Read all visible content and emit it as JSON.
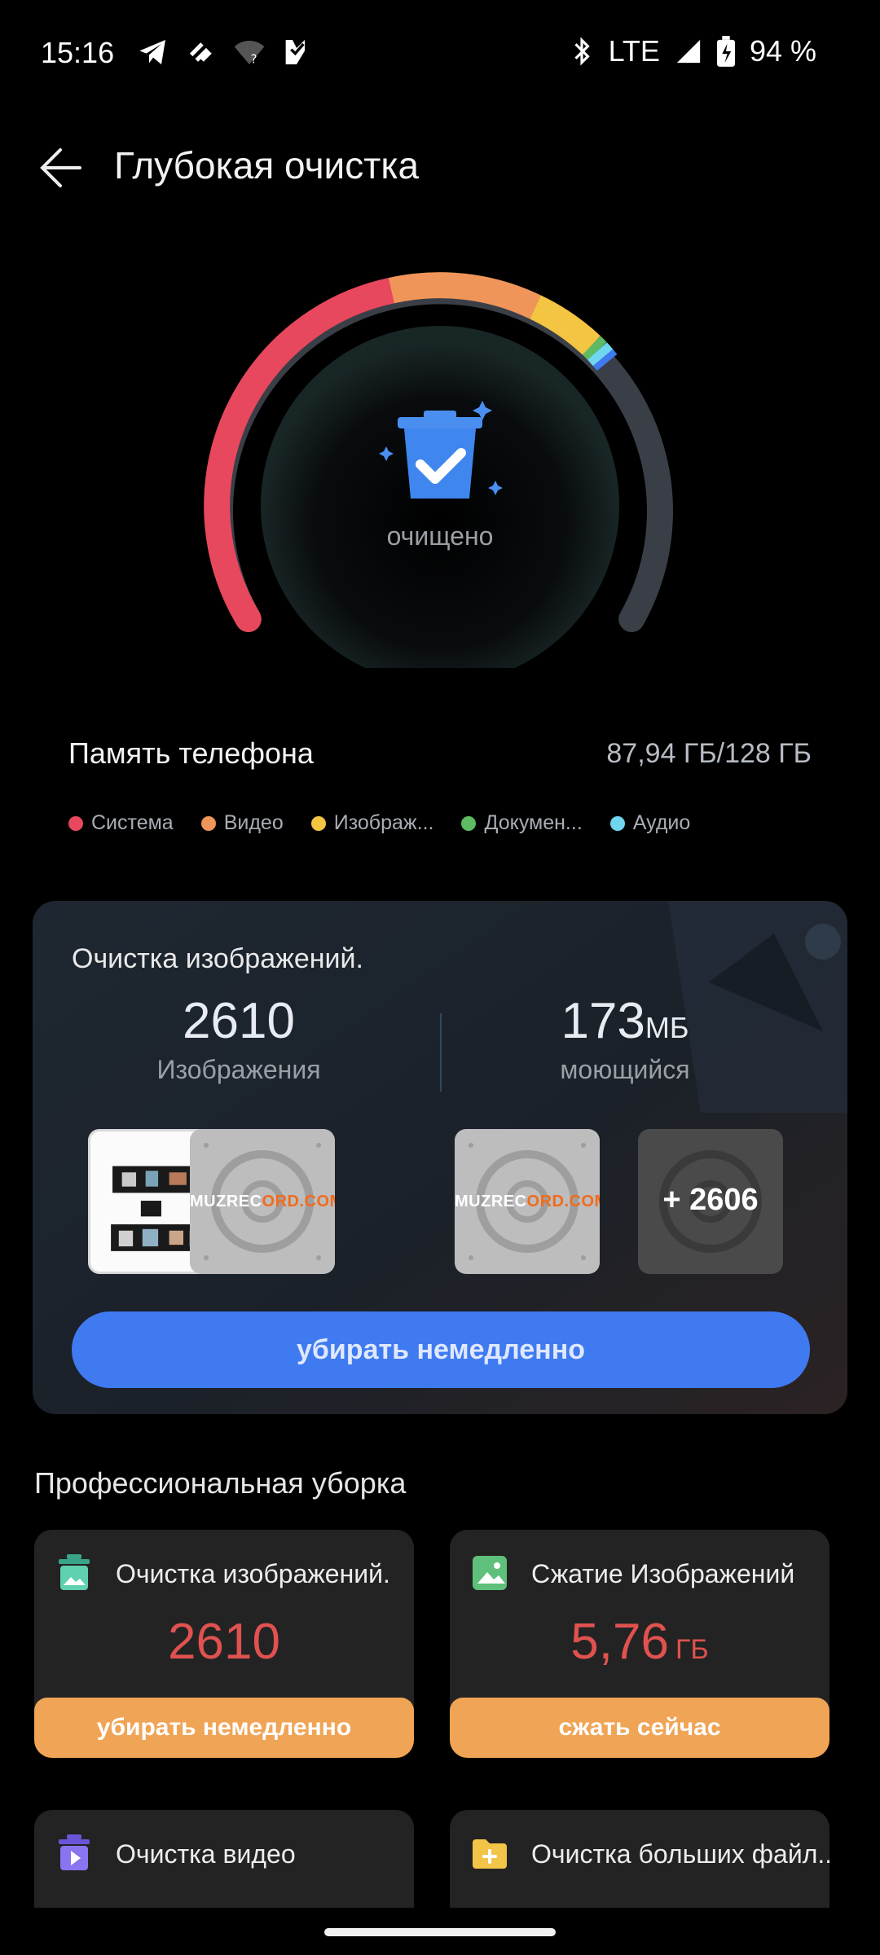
{
  "status_bar": {
    "time": "15:16",
    "network": "LTE",
    "battery": "94 %"
  },
  "header": {
    "title": "Глубокая очистка"
  },
  "gauge": {
    "status": "очищено"
  },
  "memory": {
    "label": "Память телефона",
    "value": "87,94 ГБ/128 ГБ",
    "legend": [
      {
        "label": "Система",
        "color": "#e8485d"
      },
      {
        "label": "Видео",
        "color": "#f0955a"
      },
      {
        "label": "Изображ...",
        "color": "#f4c542"
      },
      {
        "label": "Докумен...",
        "color": "#5dbb63"
      },
      {
        "label": "Аудио",
        "color": "#6fd6f0"
      }
    ]
  },
  "image_cleanup": {
    "title": "Очистка изображений.",
    "count": "2610",
    "count_label": "Изображения",
    "size": "173",
    "size_unit": "МБ",
    "size_label": "моющийся",
    "thumb_text_1": "MUZREC",
    "thumb_text_2": "ORD.COM",
    "more_count": "+ 2606",
    "button": "убирать немедленно"
  },
  "pro": {
    "title": "Профессиональная уборка",
    "tiles": [
      {
        "title": "Очистка изображений.",
        "value": "2610",
        "unit": "",
        "button": "убирать немедленно"
      },
      {
        "title": "Сжатие Изображений",
        "value": "5,76",
        "unit": "ГБ",
        "button": "сжать сейчас"
      },
      {
        "title": "Очистка видео"
      },
      {
        "title": "Очистка больших файл..."
      }
    ]
  }
}
